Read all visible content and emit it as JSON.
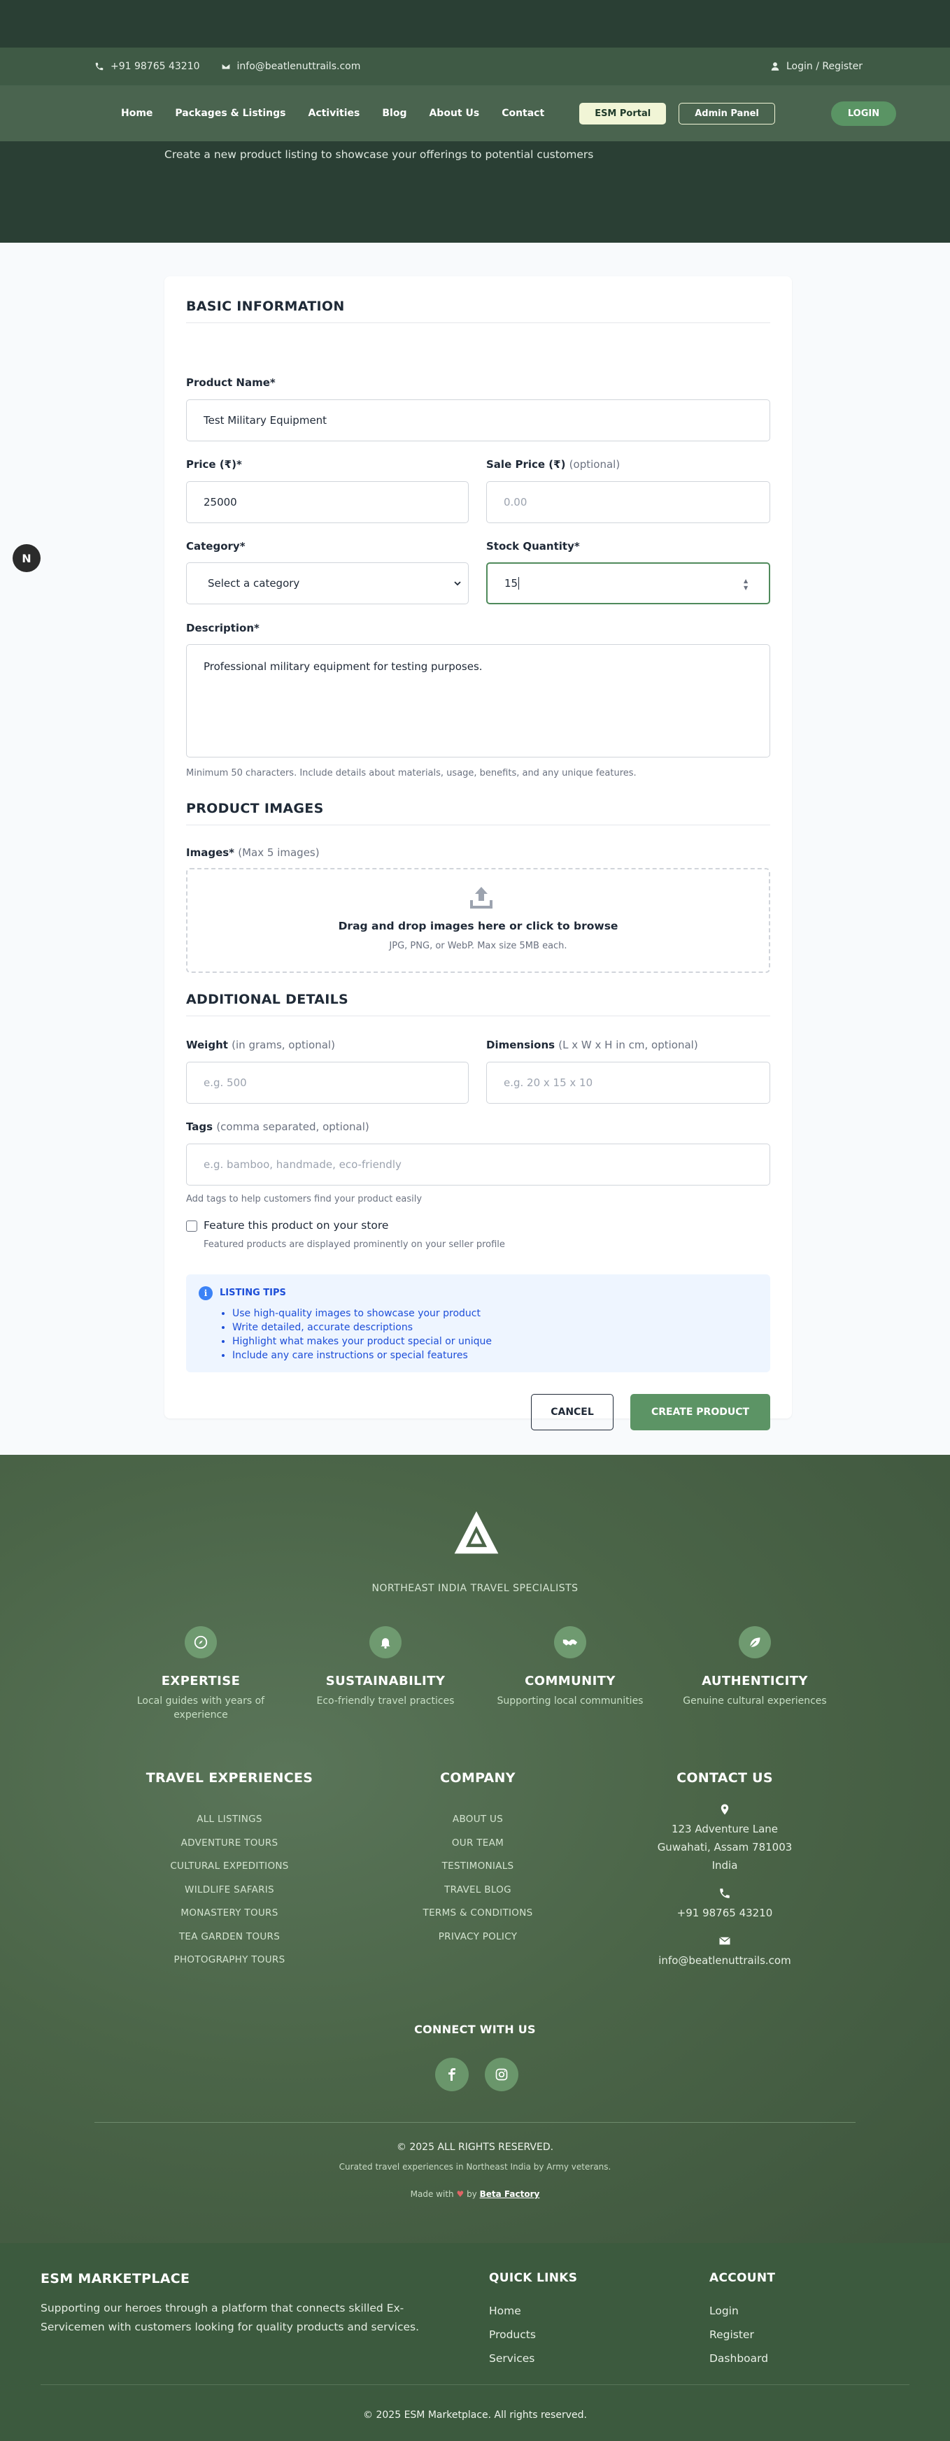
{
  "topbar": {
    "phone": "+91 98765 43210",
    "email": "info@beatlenuttrails.com",
    "login_register": "Login / Register"
  },
  "nav": {
    "links": [
      "Home",
      "Packages & Listings",
      "Activities",
      "Blog",
      "About Us",
      "Contact"
    ],
    "esm_portal": "ESM Portal",
    "admin_panel": "Admin Panel",
    "login": "LOGIN"
  },
  "hero": {
    "subtitle": "Create a new product listing to showcase your offerings to potential customers"
  },
  "form": {
    "basic_title": "BASIC INFORMATION",
    "product_name_label": "Product Name*",
    "product_name_value": "Test Military Equipment",
    "price_label": "Price (₹)*",
    "price_value": "25000",
    "sale_price_label": "Sale Price (₹)",
    "sale_price_opt": "(optional)",
    "sale_price_placeholder": "0.00",
    "category_label": "Category*",
    "category_selected": "Select a category",
    "stock_label": "Stock Quantity*",
    "stock_value": "15",
    "description_label": "Description*",
    "description_value": "Professional military equipment for testing purposes.",
    "description_help": "Minimum 50 characters. Include details about materials, usage, benefits, and any unique features.",
    "images_title": "PRODUCT IMAGES",
    "images_label": "Images*",
    "images_opt": "(Max 5 images)",
    "dropzone_main": "Drag and drop images here or click to browse",
    "dropzone_sub": "JPG, PNG, or WebP. Max size 5MB each.",
    "additional_title": "ADDITIONAL DETAILS",
    "weight_label": "Weight",
    "weight_opt": "(in grams, optional)",
    "weight_placeholder": "e.g. 500",
    "dimensions_label": "Dimensions",
    "dimensions_opt": "(L x W x H in cm, optional)",
    "dimensions_placeholder": "e.g. 20 x 15 x 10",
    "tags_label": "Tags",
    "tags_opt": "(comma separated, optional)",
    "tags_placeholder": "e.g. bamboo, handmade, eco-friendly",
    "tags_help": "Add tags to help customers find your product easily",
    "feature_label": "Feature this product on your store",
    "feature_help": "Featured products are displayed prominently on your seller profile",
    "tips_title": "LISTING TIPS",
    "tips": [
      "Use high-quality images to showcase your product",
      "Write detailed, accurate descriptions",
      "Highlight what makes your product special or unique",
      "Include any care instructions or special features"
    ],
    "cancel": "CANCEL",
    "create": "CREATE PRODUCT"
  },
  "footer": {
    "tagline": "NORTHEAST INDIA TRAVEL SPECIALISTS",
    "features": [
      {
        "title": "EXPERTISE",
        "desc": "Local guides with years of experience",
        "icon": "compass-icon"
      },
      {
        "title": "SUSTAINABILITY",
        "desc": "Eco-friendly travel practices",
        "icon": "bell-icon"
      },
      {
        "title": "COMMUNITY",
        "desc": "Supporting local communities",
        "icon": "handshake-icon"
      },
      {
        "title": "AUTHENTICITY",
        "desc": "Genuine cultural experiences",
        "icon": "leaf-icon"
      }
    ],
    "travel_title": "TRAVEL EXPERIENCES",
    "travel_links": [
      "ALL LISTINGS",
      "ADVENTURE TOURS",
      "CULTURAL EXPEDITIONS",
      "WILDLIFE SAFARIS",
      "MONASTERY TOURS",
      "TEA GARDEN TOURS",
      "PHOTOGRAPHY TOURS"
    ],
    "company_title": "COMPANY",
    "company_links": [
      "ABOUT US",
      "OUR TEAM",
      "TESTIMONIALS",
      "TRAVEL BLOG",
      "TERMS & CONDITIONS",
      "PRIVACY POLICY"
    ],
    "contact_title": "CONTACT US",
    "address_lines": [
      "123 Adventure Lane",
      "Guwahati, Assam 781003",
      "India"
    ],
    "phone": "+91 98765 43210",
    "email": "info@beatlenuttrails.com",
    "connect": "CONNECT WITH US",
    "copyright": "© 2025 ALL RIGHTS RESERVED.",
    "curated": "Curated travel experiences in Northeast India by Army veterans.",
    "made_prefix": "Made with",
    "made_by": "by",
    "made_link": "Beta Factory"
  },
  "esm_footer": {
    "title": "ESM MARKETPLACE",
    "desc": "Supporting our heroes through a platform that connects skilled Ex-Servicemen with customers looking for quality products and services.",
    "quick_title": "QUICK LINKS",
    "quick_links": [
      "Home",
      "Products",
      "Services"
    ],
    "account_title": "ACCOUNT",
    "account_links": [
      "Login",
      "Register",
      "Dashboard"
    ],
    "copyright": "© 2025 ESM Marketplace. All rights reserved."
  },
  "colors": {
    "hero_bg": "#2a3f34",
    "accent_green": "#5c9465",
    "footer_bg": "#4b6548",
    "esm_footer_bg": "#3c5a3e",
    "tips_bg": "#eef5ff",
    "tips_text": "#1d4ed8"
  }
}
